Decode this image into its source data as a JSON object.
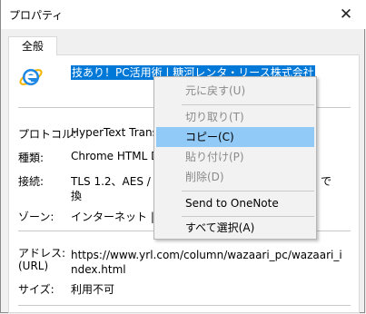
{
  "window": {
    "title": "プロパティ",
    "close_glyph": "✕"
  },
  "tabs": [
    {
      "label": "全般"
    }
  ],
  "page": {
    "title": "技あり！PC活用術 | 糖河レンタ・リース株式会社",
    "icon": "internet-explorer-icon"
  },
  "properties": {
    "protocol": {
      "label": "プロトコル:",
      "value": "HyperText Transf"
    },
    "type": {
      "label": "種類:",
      "value": "Chrome HTML Do"
    },
    "connection": {
      "label": "接続:",
      "value_line1": "TLS 1.2、AES / 12",
      "value_line1_end": "で",
      "value_line2": "換"
    },
    "zone": {
      "label": "ゾーン:",
      "value": "インターネット | 保護"
    },
    "address": {
      "label_line1": "アドレス:",
      "label_line2": "(URL)",
      "value": "https://www.yrl.com/column/wazaari_pc/wazaari_index.html"
    },
    "size": {
      "label": "サイズ:",
      "value": "利用不可"
    }
  },
  "context_menu": {
    "items": [
      {
        "label": "元に戻す(U)",
        "enabled": false
      },
      {
        "label": "切り取り(T)",
        "enabled": false
      },
      {
        "label": "コピー(C)",
        "enabled": true,
        "highlighted": true
      },
      {
        "label": "貼り付け(P)",
        "enabled": false
      },
      {
        "label": "削除(D)",
        "enabled": false
      },
      {
        "label": "Send to OneNote",
        "enabled": true
      },
      {
        "label": "すべて選択(A)",
        "enabled": true
      }
    ]
  },
  "colors": {
    "selection": "#0078d7",
    "menu_highlight": "#91c9f7",
    "disabled_text": "#8a8a8a"
  }
}
